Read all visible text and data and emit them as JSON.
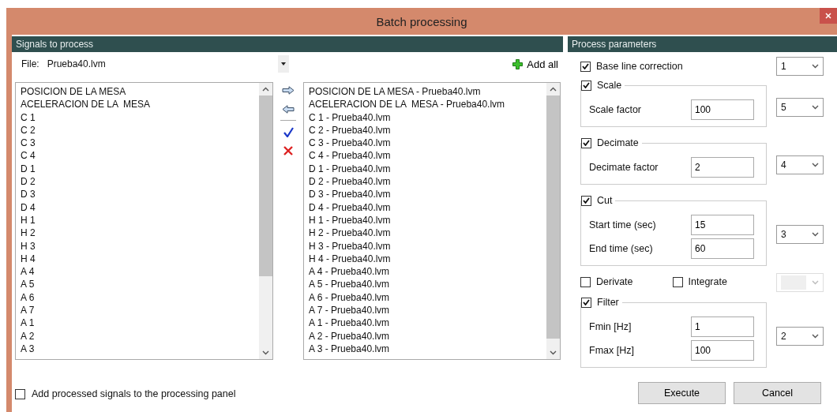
{
  "window": {
    "title": "Batch processing"
  },
  "signals_panel": {
    "header": "Signals to process",
    "file_label": "File:",
    "file_value": "Prueba40.lvm",
    "add_all": "Add all",
    "available": [
      "POSICION DE LA MESA",
      "ACELERACION DE LA  MESA",
      "C 1",
      "C 2",
      "C 3",
      "C 4",
      "D 1",
      "D 2",
      "D 3",
      "D 4",
      "H 1",
      "H 2",
      "H 3",
      "H 4",
      "A 4",
      "A 5",
      "A 6",
      "A 7",
      "A 1",
      "A 2",
      "A 3"
    ],
    "selected_signals": [
      "POSICION DE LA MESA - Prueba40.lvm",
      "ACELERACION DE LA  MESA - Prueba40.lvm",
      "C 1 - Prueba40.lvm",
      "C 2 - Prueba40.lvm",
      "C 3 - Prueba40.lvm",
      "C 4 - Prueba40.lvm",
      "D 1 - Prueba40.lvm",
      "D 2 - Prueba40.lvm",
      "D 3 - Prueba40.lvm",
      "D 4 - Prueba40.lvm",
      "H 1 - Prueba40.lvm",
      "H 2 - Prueba40.lvm",
      "H 3 - Prueba40.lvm",
      "H 4 - Prueba40.lvm",
      "A 4 - Prueba40.lvm",
      "A 5 - Prueba40.lvm",
      "A 6 - Prueba40.lvm",
      "A 7 - Prueba40.lvm",
      "A 1 - Prueba40.lvm",
      "A 2 - Prueba40.lvm",
      "A 3 - Prueba40.lvm"
    ],
    "add_to_panel": {
      "label": "Add processed signals to the processing panel",
      "checked": false
    }
  },
  "parameters_panel": {
    "header": "Process parameters",
    "steps": [
      {
        "kind": "check",
        "label": "Base line correction",
        "checked": true,
        "order": "1"
      },
      {
        "kind": "group",
        "label": "Scale",
        "checked": true,
        "order": "5",
        "fields": [
          {
            "label": "Scale factor",
            "value": "100"
          }
        ]
      },
      {
        "kind": "group",
        "label": "Decimate",
        "checked": true,
        "order": "4",
        "fields": [
          {
            "label": "Decimate factor",
            "value": "2"
          }
        ]
      },
      {
        "kind": "group",
        "label": "Cut",
        "checked": true,
        "order": "3",
        "fields": [
          {
            "label": "Start time (sec)",
            "value": "15"
          },
          {
            "label": "End time (sec)",
            "value": "60"
          }
        ]
      },
      {
        "kind": "pair",
        "options": [
          {
            "label": "Derivate",
            "checked": false
          },
          {
            "label": "Integrate",
            "checked": false
          }
        ],
        "order_disabled": true
      },
      {
        "kind": "group",
        "label": "Filter",
        "checked": true,
        "order": "2",
        "fields": [
          {
            "label": "Fmin [Hz]",
            "value": "1"
          },
          {
            "label": "Fmax [Hz]",
            "value": "100"
          }
        ]
      }
    ]
  },
  "buttons": [
    "Execute",
    "Cancel"
  ]
}
